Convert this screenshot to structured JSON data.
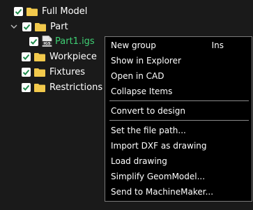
{
  "tree": {
    "items": [
      {
        "label": "Full Model",
        "checked": true,
        "icon": "folder-icon"
      },
      {
        "label": "Part",
        "checked": true,
        "icon": "folder-icon",
        "expanded": true
      },
      {
        "label": "Part1.igs",
        "checked": true,
        "icon": "igs-file-icon",
        "selected": true
      },
      {
        "label": "Workpiece",
        "checked": true,
        "icon": "folder-icon"
      },
      {
        "label": "Fixtures",
        "checked": true,
        "icon": "folder-icon"
      },
      {
        "label": "Restrictions",
        "checked": true,
        "icon": "folder-icon"
      }
    ],
    "file_icon_text": "IGS"
  },
  "context_menu": {
    "groups": [
      [
        {
          "label": "New group",
          "shortcut": "Ins"
        },
        {
          "label": "Show in Explorer",
          "shortcut": ""
        },
        {
          "label": "Open in CAD",
          "shortcut": ""
        },
        {
          "label": "Collapse Items",
          "shortcut": ""
        }
      ],
      [
        {
          "label": "Convert to design",
          "shortcut": ""
        }
      ],
      [
        {
          "label": "Set the file path...",
          "shortcut": ""
        },
        {
          "label": "Import DXF as drawing",
          "shortcut": ""
        },
        {
          "label": "Load drawing",
          "shortcut": ""
        },
        {
          "label": "Simplify GeomModel...",
          "shortcut": ""
        },
        {
          "label": "Send to MachineMaker...",
          "shortcut": ""
        }
      ]
    ]
  },
  "colors": {
    "background": "#1a1a1a",
    "checkbox_check": "#1e8a4a",
    "folder": "#f2c94c",
    "selected_text": "#3fcf74",
    "menu_background": "#000000",
    "menu_border": "#7a7a7a"
  }
}
